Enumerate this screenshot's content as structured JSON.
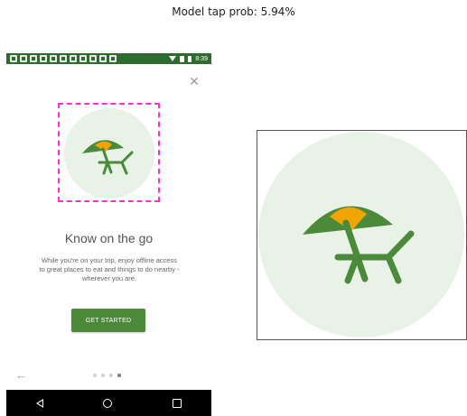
{
  "caption": "Model tap prob: 5.94%",
  "status_bar": {
    "time": "8:39",
    "notification_count": 11
  },
  "illustration": {
    "icon": "beach-umbrella-lounge-chair",
    "circle_color": "#e8f2e6",
    "green": "#4b8a3a",
    "accent": "#f2a500"
  },
  "onboarding": {
    "title": "Know on the go",
    "body": "While you're on your trip, enjoy offline access\nto great places to eat and things to do nearby -\nwherever you are.",
    "button_label": "GET STARTED",
    "page_count": 4,
    "active_page": 4
  },
  "colors": {
    "status_bar": "#2f6b2f",
    "button": "#4b8a3a",
    "highlight_border": "#ff2fd4"
  }
}
